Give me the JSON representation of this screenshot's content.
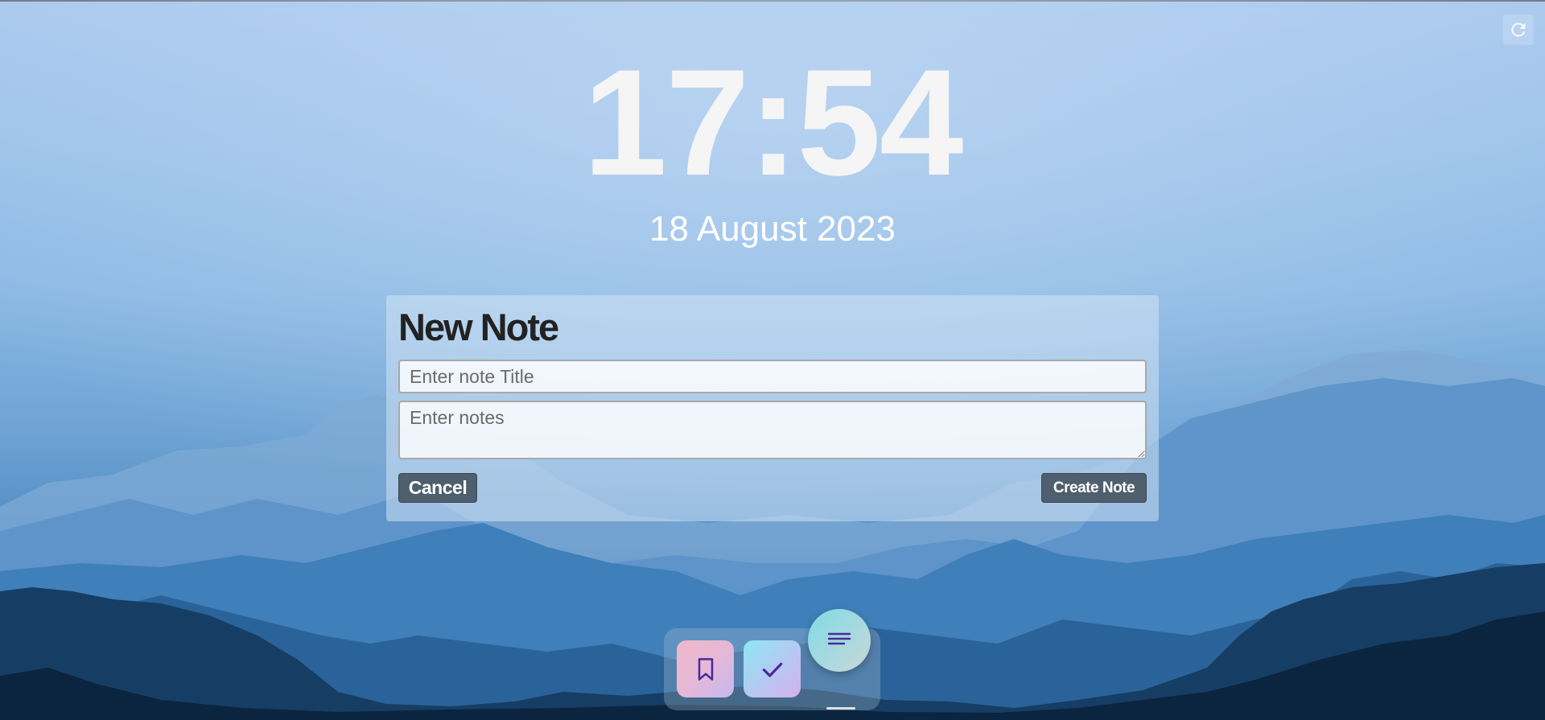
{
  "clock": {
    "time": "17:54",
    "date": "18 August 2023"
  },
  "refresh": {
    "icon": "refresh-icon"
  },
  "note_form": {
    "heading": "New Note",
    "title_placeholder": "Enter note Title",
    "title_value": "",
    "notes_placeholder": "Enter notes",
    "notes_value": "",
    "cancel_label": "Cancel",
    "create_label": "Create Note"
  },
  "dock": {
    "items": [
      {
        "name": "bookmark",
        "icon": "bookmark-icon"
      },
      {
        "name": "todo",
        "icon": "checkmark-icon"
      }
    ],
    "fab_icon": "notes-lines-icon"
  },
  "colors": {
    "button_bg": "#4f5f6e",
    "icon_purple": "#4a2a9a",
    "text_white": "#ffffff"
  }
}
